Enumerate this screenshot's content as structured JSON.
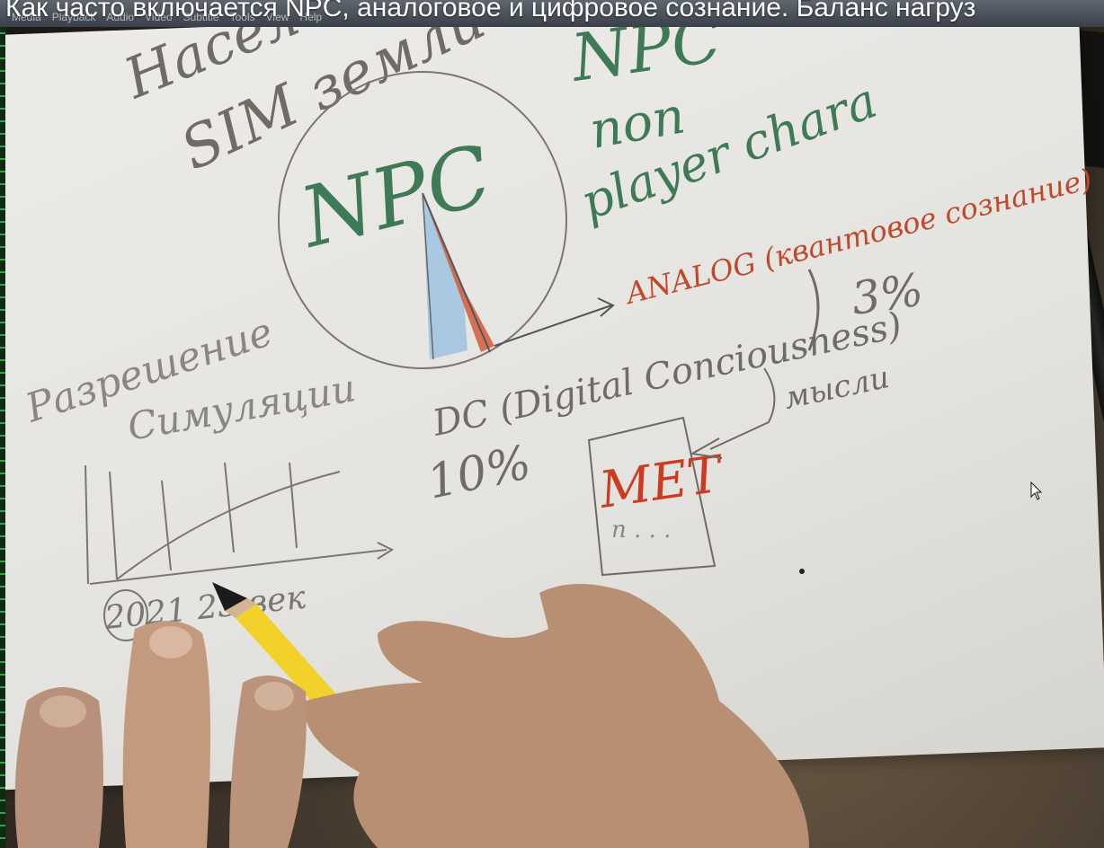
{
  "window": {
    "video_title": "Как часто включается NPC, аналоговое и цифровое сознание. Баланс нагруз"
  },
  "menu": {
    "items": [
      "Media",
      "Playback",
      "Audio",
      "Video",
      "Subtitle",
      "Tools",
      "View",
      "Help"
    ]
  },
  "drawing": {
    "top_left_words": [
      "Насел",
      "SIM земли"
    ],
    "circle_label": "NPC",
    "npc_note": [
      "NPC",
      "non",
      "player chara"
    ],
    "analog_label": "ANALOG (квантовое сознание)",
    "analog_percent": "3%",
    "dc_label": "DC (Digital Conciousness)",
    "dc_percent": "10%",
    "left_word_1": "Разрешение",
    "left_word_2": "Симуляции",
    "graph_axis_label": "2021  23 век",
    "box_label": "МЕТ",
    "box_small_text": "п . . .",
    "arrow_note": "мысли"
  },
  "colors": {
    "pencil_gray": "#6f6c66",
    "green_ink": "#3e7a55",
    "red_ink": "#c0492c",
    "blue_shade": "#9cc3e0",
    "pencil_yellow": "#f2d22a"
  },
  "icons": {
    "cursor": "mouse-pointer-icon"
  }
}
